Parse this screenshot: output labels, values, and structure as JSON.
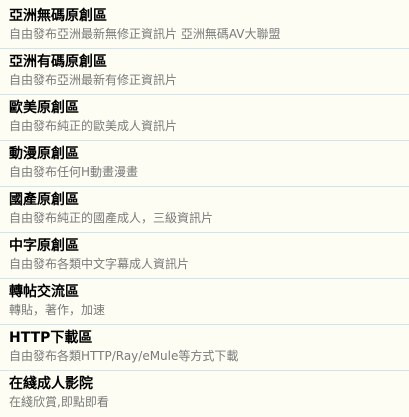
{
  "forums": [
    {
      "title": "亞洲無碼原創區",
      "desc": "自由發布亞洲最新無修正資訊片 亞洲無碼AV大聯盟"
    },
    {
      "title": "亞洲有碼原創區",
      "desc": "自由發布亞洲最新有修正資訊片"
    },
    {
      "title": "歐美原創區",
      "desc": "自由發布純正的歐美成人資訊片"
    },
    {
      "title": "動漫原創區",
      "desc": "自由發布任何H動畫漫畫"
    },
    {
      "title": "國產原創區",
      "desc": "自由發布純正的國產成人，三級資訊片"
    },
    {
      "title": "中字原創區",
      "desc": "自由發布各類中文字幕成人資訊片"
    },
    {
      "title": "轉帖交流區",
      "desc": "轉貼，著作，加速"
    },
    {
      "title": "HTTP下載區",
      "desc": "自由發布各類HTTP/Ray/eMule等方式下載"
    },
    {
      "title": "在綫成人影院",
      "desc": "在綫欣賞,即點即看"
    }
  ]
}
